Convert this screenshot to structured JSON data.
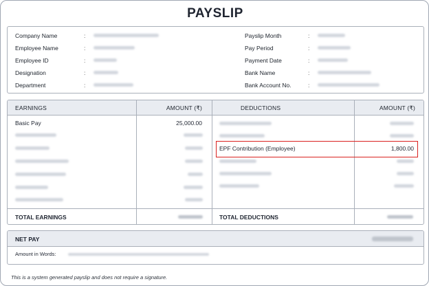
{
  "title": "PAYSLIP",
  "info": {
    "left": [
      {
        "label": "Company Name"
      },
      {
        "label": "Employee Name"
      },
      {
        "label": "Employee ID"
      },
      {
        "label": "Designation"
      },
      {
        "label": "Department"
      }
    ],
    "right": [
      {
        "label": "Payslip Month"
      },
      {
        "label": "Pay Period"
      },
      {
        "label": "Payment Date"
      },
      {
        "label": "Bank Name"
      },
      {
        "label": "Bank Account No."
      }
    ],
    "colon": ":"
  },
  "table": {
    "headers": {
      "earnings": "EARNINGS",
      "earnings_amount": "AMOUNT (₹)",
      "deductions": "DEDUCTIONS",
      "deductions_amount": "AMOUNT (₹)"
    },
    "earnings_first": {
      "label": "Basic Pay",
      "amount": "25,000.00"
    },
    "deduction_highlight": {
      "label": "EPF Contribution (Employee)",
      "amount": "1,800.00"
    },
    "total_earnings_label": "TOTAL EARNINGS",
    "total_deductions_label": "TOTAL DEDUCTIONS"
  },
  "net": {
    "label": "NET PAY",
    "words_label": "Amount in Words:"
  },
  "footer": "This is a system generated payslip and does not require a signature.",
  "colors": {
    "highlight": "#d9201e",
    "header_bg": "#e9ecf1"
  }
}
